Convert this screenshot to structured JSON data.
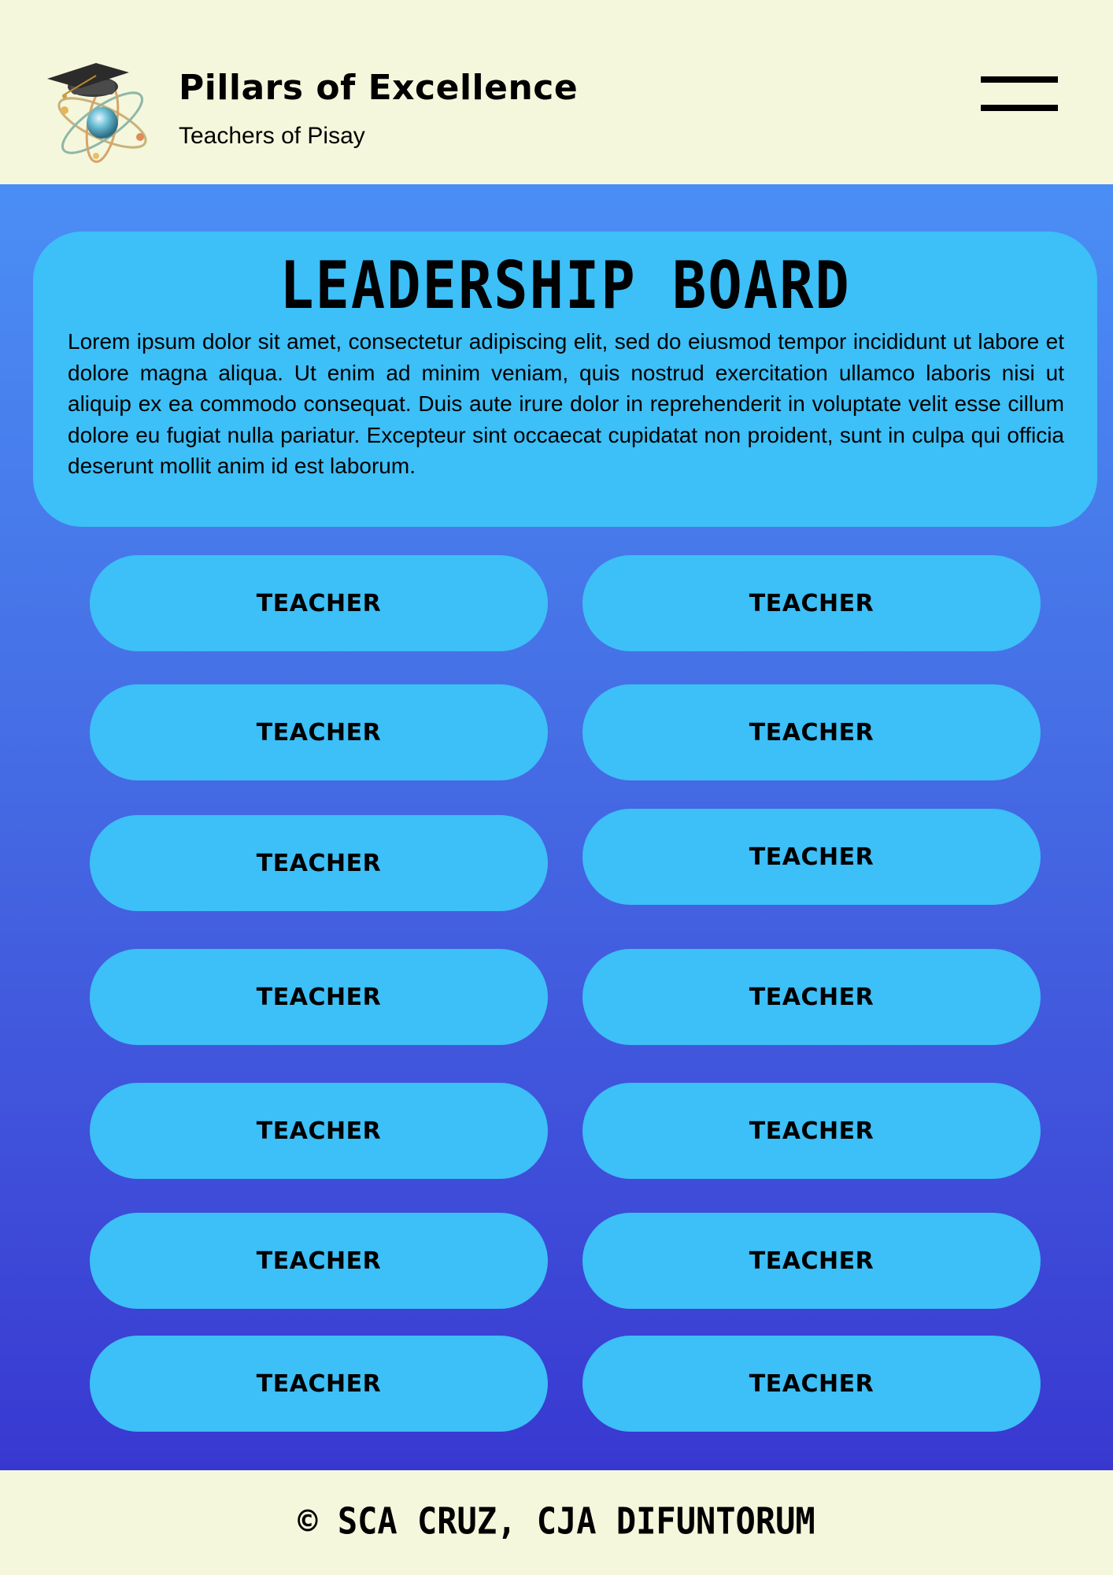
{
  "header": {
    "title": "Pillars of Excellence",
    "subtitle": "Teachers of Pisay",
    "logo_icon": "graduation-cap-atom-icon",
    "menu_icon": "hamburger-menu-icon"
  },
  "board": {
    "title": "LEADERSHIP BOARD",
    "description": "Lorem ipsum dolor sit amet, consectetur adipiscing elit, sed do eiusmod tempor incididunt ut labore et dolore magna aliqua. Ut enim ad minim veniam, quis nostrud exercitation ullamco laboris nisi ut aliquip ex ea commodo consequat. Duis aute irure dolor in reprehenderit in voluptate velit esse cillum dolore eu fugiat nulla pariatur. Excepteur sint occaecat cupidatat non proident, sunt in culpa qui officia deserunt mollit anim id est laborum."
  },
  "teachers": [
    {
      "label": "TEACHER"
    },
    {
      "label": "TEACHER"
    },
    {
      "label": "TEACHER"
    },
    {
      "label": "TEACHER"
    },
    {
      "label": "TEACHER"
    },
    {
      "label": "TEACHER"
    },
    {
      "label": "TEACHER"
    },
    {
      "label": "TEACHER"
    },
    {
      "label": "TEACHER"
    },
    {
      "label": "TEACHER"
    },
    {
      "label": "TEACHER"
    },
    {
      "label": "TEACHER"
    },
    {
      "label": "TEACHER"
    },
    {
      "label": "TEACHER"
    }
  ],
  "footer": {
    "copyright": "© SCA CRUZ, CJA DIFUNTORUM"
  },
  "colors": {
    "header_bg": "#f5f7dc",
    "card_bg": "#3dbff7",
    "gradient_top": "#4a8ef5",
    "gradient_bottom": "#3838d0"
  }
}
